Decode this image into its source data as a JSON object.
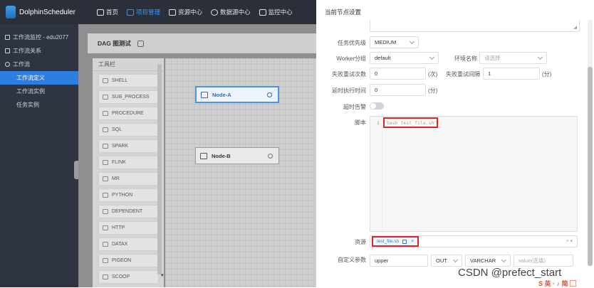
{
  "app": {
    "name": "DolphinScheduler"
  },
  "nav": [
    {
      "label": "首页"
    },
    {
      "label": "项目管理"
    },
    {
      "label": "资源中心"
    },
    {
      "label": "数据源中心"
    },
    {
      "label": "监控中心"
    }
  ],
  "sidebar": {
    "items": [
      {
        "label": "工作流监控 - edu2077"
      },
      {
        "label": "工作流关系"
      },
      {
        "label": "工作流"
      },
      {
        "label": "工作流定义"
      },
      {
        "label": "工作流实例"
      },
      {
        "label": "任务实例"
      }
    ]
  },
  "dag": {
    "title": "DAG 图测试",
    "toolbar_title": "工具栏",
    "tools": [
      "SHELL",
      "SUB_PROCESS",
      "PROCEDURE",
      "SQL",
      "SPARK",
      "FLINK",
      "MR",
      "PYTHON",
      "DEPENDENT",
      "HTTP",
      "DATAX",
      "PIGEON",
      "SCOOP"
    ],
    "nodes": [
      {
        "label": "Node-A"
      },
      {
        "label": "Node-B"
      }
    ]
  },
  "drawer": {
    "title": "当前节点设置",
    "priority": {
      "label": "任务优先级",
      "value": "MEDIUM"
    },
    "worker": {
      "label": "Worker分组",
      "value": "default"
    },
    "env": {
      "label": "环境名称",
      "placeholder": "请选择"
    },
    "retry_times": {
      "label": "失败重试次数",
      "value": "0",
      "unit": "(次)"
    },
    "retry_interval": {
      "label": "失败重试间隔",
      "value": "1",
      "unit": "(分)"
    },
    "delay": {
      "label": "延时执行时间",
      "value": "0",
      "unit": "(分)"
    },
    "timeout": {
      "label": "超时告警"
    },
    "script": {
      "label": "脚本",
      "line_no": "1",
      "code": "bash test_file.sh"
    },
    "resource": {
      "label": "资源",
      "tag": "test_file.sh",
      "tag_close": "×",
      "end": "× ▾"
    },
    "custom": {
      "label": "自定义参数",
      "value": "upper",
      "direct": "OUT",
      "type": "VARCHAR",
      "placeholder": "value(选填)"
    }
  },
  "watermark": {
    "text": "CSDN @prefect_start",
    "badge": "S 英 · ♪ 简 ⬚"
  }
}
